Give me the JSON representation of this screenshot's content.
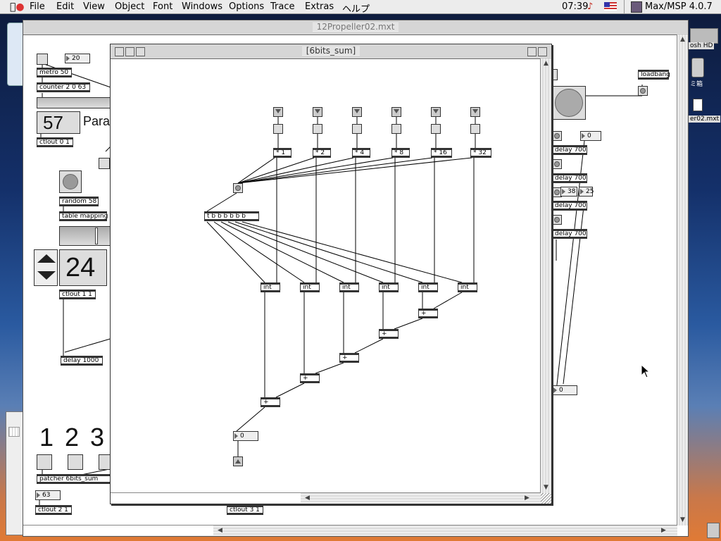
{
  "menubar": {
    "apple_icon": "apple-icon",
    "items": [
      "File",
      "Edit",
      "View",
      "Object",
      "Font",
      "Windows",
      "Options",
      "Trace",
      "Extras",
      "ヘルプ"
    ],
    "clock": "07:39",
    "app_name": "Max/MSP 4.0.7"
  },
  "back_window": {
    "title": "12Propeller02.mxt",
    "objects": {
      "num_20": "20",
      "metro": "metro 50",
      "counter": "counter 2 0 63",
      "big_57": "57",
      "para_label": "Para",
      "ctlout_0_1": "ctlout 0 1",
      "random": "random 58",
      "table_mapping": "table mapping",
      "big_24": "24",
      "ctlout_1_1": "ctlout 1 1",
      "delay_1000": "delay 1000",
      "big_1": "1",
      "big_2": "2",
      "big_3": "3",
      "patcher": "patcher 6bits_sum",
      "num_63": "63",
      "ctlout_2_1": "ctlout 2 1",
      "ctlout_3_1": "ctlout 3 1",
      "loadbang": "loadbang",
      "num_0_right": "0",
      "delay_700_a": "delay 700",
      "delay_700_b": "delay 700",
      "delay_700_c": "delay 700",
      "delay_700_d": "delay 700",
      "num_38": "38",
      "num_25": "25",
      "num_0_bottom": "0"
    }
  },
  "desktop": {
    "hd_label": "osh HD",
    "trash_label": "ミ箱",
    "file_label": "er02.mxt"
  },
  "front_window": {
    "title": "[6bits_sum]",
    "mults": [
      "* 1",
      "* 2",
      "* 4",
      "* 8",
      "* 16",
      "* 32"
    ],
    "trigger": "t b b b b b b",
    "ints": [
      "int",
      "int",
      "int",
      "int",
      "int",
      "int"
    ],
    "adds": [
      "+",
      "+",
      "+",
      "+",
      "+"
    ],
    "result": "0"
  }
}
